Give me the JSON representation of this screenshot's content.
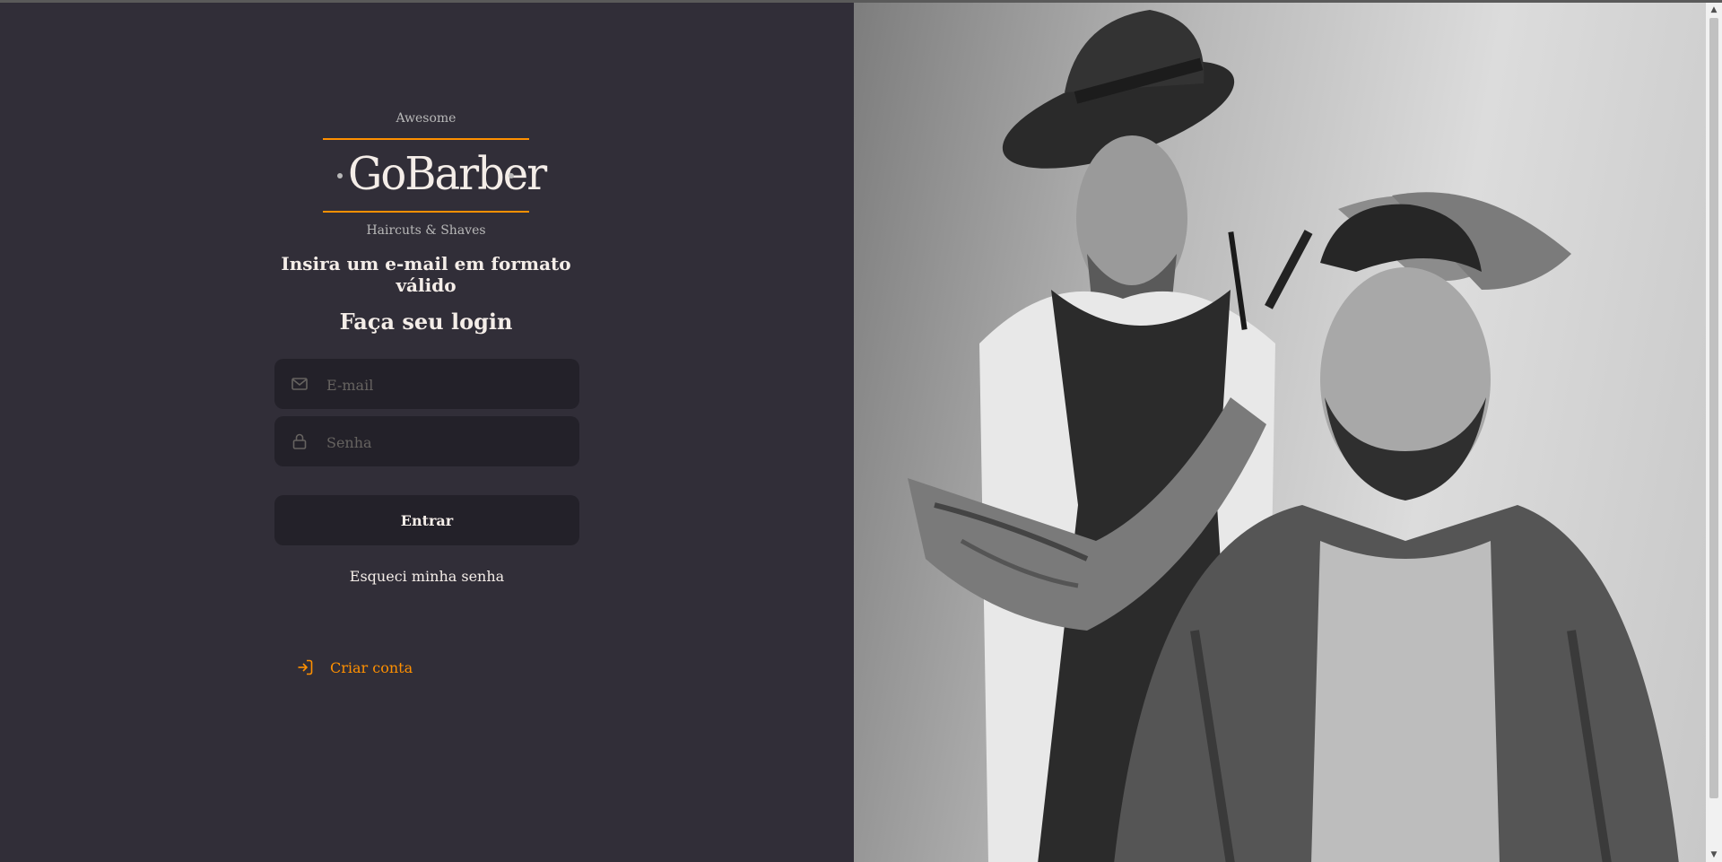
{
  "logo": {
    "top_text": "Awesome",
    "name": "GoBarber",
    "bottom_text": "Haircuts & Shaves",
    "accent_color": "#ff9000"
  },
  "form": {
    "error_message": "Insira um e-mail em formato válido",
    "title": "Faça seu login",
    "email": {
      "placeholder": "E-mail",
      "value": "",
      "icon": "mail-icon"
    },
    "password": {
      "placeholder": "Senha",
      "value": "",
      "icon": "lock-icon"
    },
    "submit_label": "Entrar",
    "forgot_label": "Esqueci minha senha"
  },
  "signup": {
    "label": "Criar conta",
    "icon": "log-in-icon"
  },
  "colors": {
    "background": "#312e38",
    "input_background": "#232129",
    "text": "#f4ede8",
    "placeholder": "#666360",
    "accent": "#ff9000"
  }
}
